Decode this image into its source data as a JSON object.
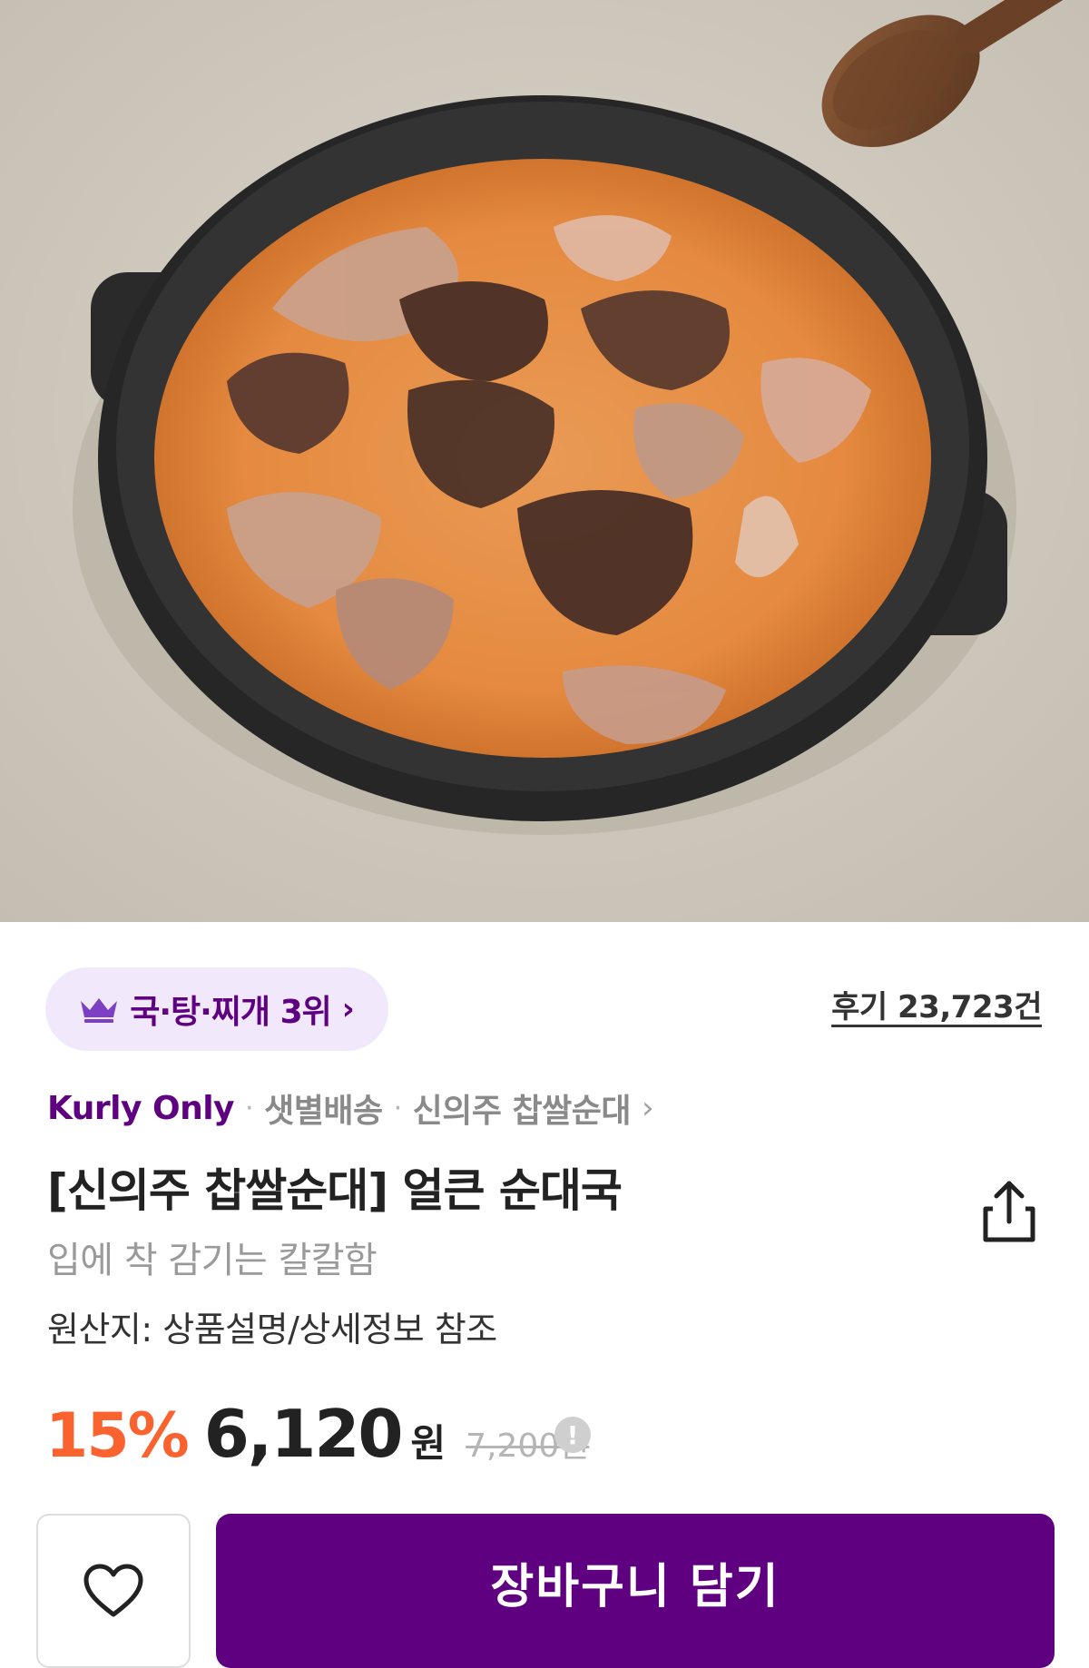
{
  "product": {
    "rank_badge": "국·탕·찌개 3위",
    "review_count": "후기 23,723건",
    "brand": "Kurly Only",
    "delivery": "샛별배송",
    "brand_link": "신의주 찹쌀순대",
    "title": "[신의주 찹쌀순대] 얼큰 순대국",
    "subtitle": "입에 착 감기는 칼칼함",
    "origin": "원산지: 상품설명/상세정보 참조"
  },
  "price": {
    "discount": "15%",
    "sale": "6,120",
    "unit": "원",
    "original": "7,200원",
    "info_icon_label": "!"
  },
  "actions": {
    "cart_label": "장바구니 담기",
    "wish_icon": "heart-icon",
    "share_icon": "share-icon"
  },
  "colors": {
    "brand_purple": "#5f0080",
    "discount_orange": "#fa622f",
    "badge_bg": "#f1e9fb"
  }
}
